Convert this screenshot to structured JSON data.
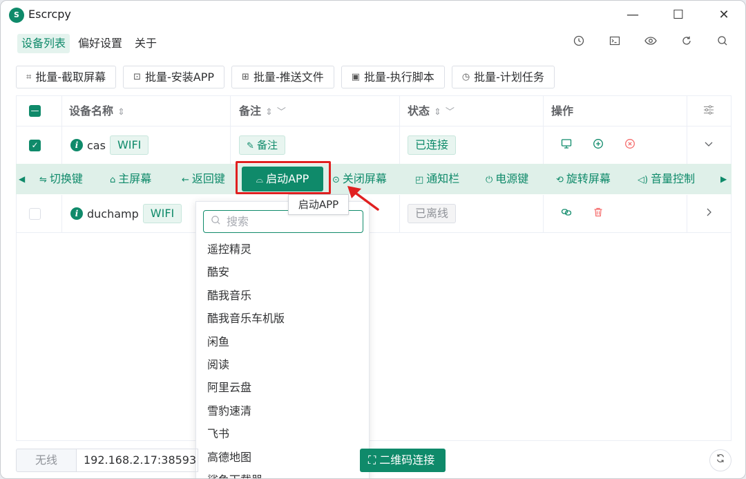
{
  "window": {
    "logo": "S",
    "title": "Escrcpy",
    "minimize": "—",
    "maximize": "☐",
    "close": "✕"
  },
  "menu": {
    "items": [
      "设备列表",
      "偏好设置",
      "关于"
    ],
    "active_index": 0
  },
  "top_icons": [
    "clock-icon",
    "terminal-icon",
    "eye-icon",
    "refresh-icon",
    "search-icon"
  ],
  "batch": {
    "buttons": [
      "批量-截取屏幕",
      "批量-安装APP",
      "批量-推送文件",
      "批量-执行脚本",
      "批量-计划任务"
    ]
  },
  "table": {
    "headers": {
      "name": "设备名称",
      "remark": "备注",
      "status": "状态",
      "actions": "操作"
    },
    "rows": [
      {
        "name": "cas",
        "type": "WIFI",
        "remark_button": "备注",
        "status": "已连接",
        "checked": true
      },
      {
        "name": "duchamp",
        "type": "WIFI",
        "status": "已离线",
        "checked": false
      }
    ]
  },
  "actionbar": {
    "items": [
      "切换键",
      "主屏幕",
      "返回键",
      "启动APP",
      "关闭屏幕",
      "通知栏",
      "电源键",
      "旋转屏幕",
      "音量控制"
    ]
  },
  "tooltip": "启动APP",
  "dropdown": {
    "search_placeholder": "搜索",
    "items": [
      "遥控精灵",
      "酷安",
      "酷我音乐",
      "酷我音乐车机版",
      "闲鱼",
      "阅读",
      "阿里云盘",
      "雪豹速清",
      "飞书",
      "高德地图",
      "鲨鱼下载器"
    ]
  },
  "footer": {
    "mode": "无线",
    "address": "192.168.2.17:38593",
    "qr_button": "二维码连接"
  },
  "colors": {
    "accent": "#0f8a6a",
    "danger": "#f56c6c",
    "highlight": "#e02020"
  }
}
